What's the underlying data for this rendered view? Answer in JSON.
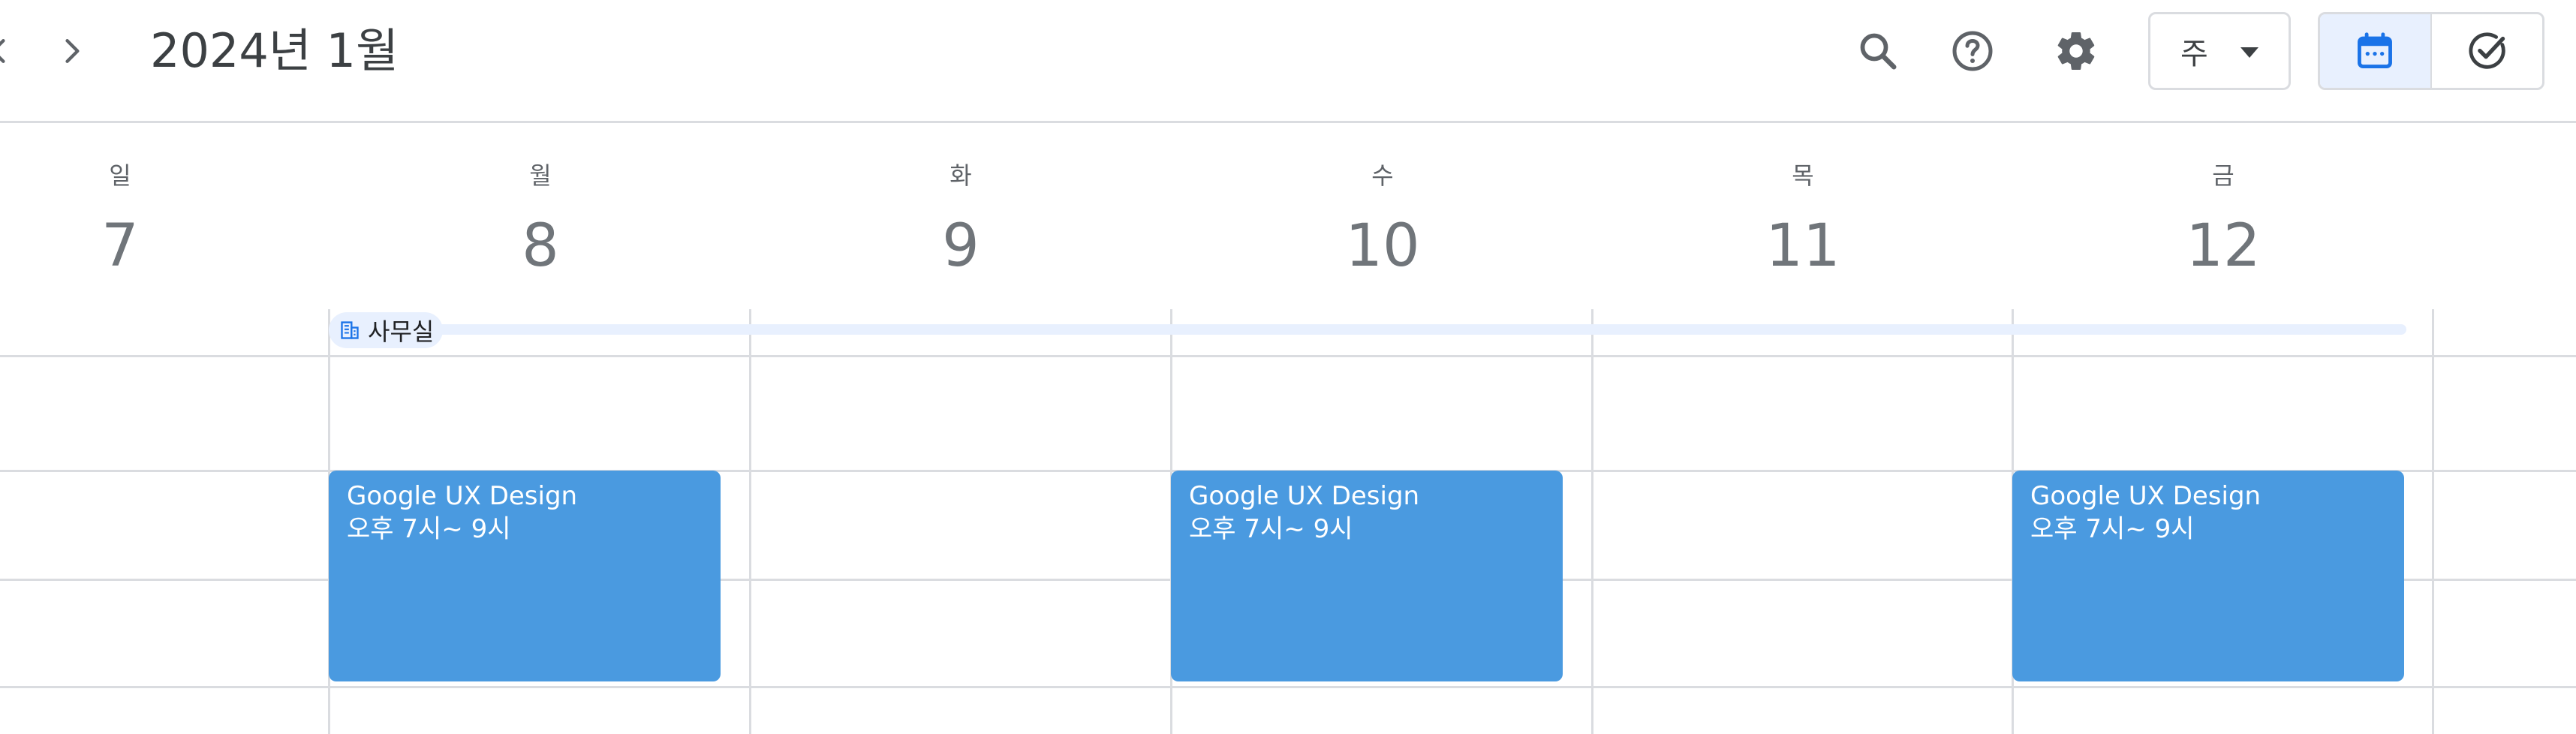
{
  "header": {
    "title": "2024년 1월",
    "prev_icon": "chevron-left-icon",
    "next_icon": "chevron-right-icon",
    "search_icon": "search-icon",
    "help_icon": "help-icon",
    "settings_icon": "gear-icon",
    "view_selector": {
      "label": "주",
      "icon": "dropdown-arrow-icon"
    },
    "segmented": {
      "calendar_icon": "calendar-icon",
      "tasks_icon": "check-circle-icon",
      "active": "calendar"
    }
  },
  "days": [
    {
      "dow": "일",
      "date": "7"
    },
    {
      "dow": "월",
      "date": "8"
    },
    {
      "dow": "화",
      "date": "9"
    },
    {
      "dow": "수",
      "date": "10"
    },
    {
      "dow": "목",
      "date": "11"
    },
    {
      "dow": "금",
      "date": "12"
    }
  ],
  "all_day": {
    "label": "사무실",
    "icon": "building-icon"
  },
  "events": [
    {
      "title": "Google UX Design",
      "time": "오후 7시~ 9시"
    },
    {
      "title": "Google UX Design",
      "time": "오후 7시~ 9시"
    },
    {
      "title": "Google UX Design",
      "time": "오후 7시~ 9시"
    }
  ],
  "colors": {
    "accent": "#1a73e8",
    "event": "#4a9ae0",
    "active_bg": "#e8f0fe",
    "grid": "#dadce0"
  }
}
